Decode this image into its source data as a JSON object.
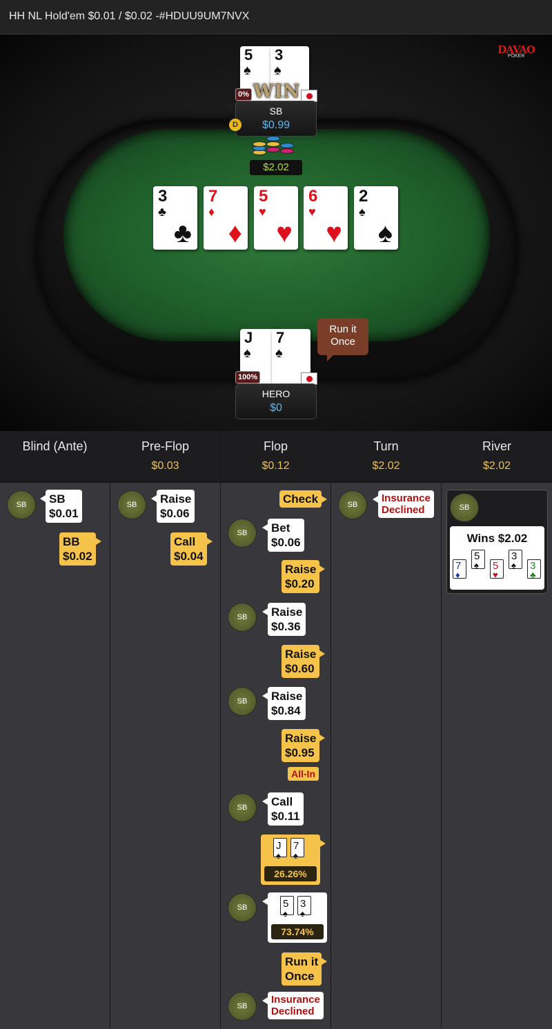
{
  "title": "HH NL Hold'em $0.01 / $0.02 -#HDUU9UM7NVX",
  "logo": {
    "text": "DAVAO",
    "sub": "POKER"
  },
  "table": {
    "top_player": {
      "name": "SB",
      "stack": "$0.99",
      "equity": "0%",
      "win_text": "WIN",
      "dealer": "D",
      "cards": [
        {
          "rank": "5",
          "suit": "♠",
          "color": "black"
        },
        {
          "rank": "3",
          "suit": "♠",
          "color": "black"
        }
      ]
    },
    "pot": "$2.02",
    "board": [
      {
        "rank": "3",
        "suit": "♣",
        "color": "black"
      },
      {
        "rank": "7",
        "suit": "♦",
        "color": "red"
      },
      {
        "rank": "5",
        "suit": "♥",
        "color": "red"
      },
      {
        "rank": "6",
        "suit": "♥",
        "color": "red"
      },
      {
        "rank": "2",
        "suit": "♠",
        "color": "black"
      }
    ],
    "hero": {
      "name": "HERO",
      "stack": "$0",
      "equity": "100%",
      "cards": [
        {
          "rank": "J",
          "suit": "♠",
          "color": "black"
        },
        {
          "rank": "7",
          "suit": "♠",
          "color": "black"
        }
      ]
    },
    "hero_bubble": {
      "line1": "Run it",
      "line2": "Once"
    }
  },
  "history": {
    "columns": [
      {
        "street": "Blind (Ante)",
        "amount": ""
      },
      {
        "street": "Pre-Flop",
        "amount": "$0.03"
      },
      {
        "street": "Flop",
        "amount": "$0.12"
      },
      {
        "street": "Turn",
        "amount": "$2.02"
      },
      {
        "street": "River",
        "amount": "$2.02"
      }
    ],
    "avatar_label": "SB",
    "blind": {
      "sb": {
        "l1": "SB",
        "l2": "$0.01"
      },
      "bb": {
        "l1": "BB",
        "l2": "$0.02"
      }
    },
    "preflop": {
      "raise": {
        "l1": "Raise",
        "l2": "$0.06"
      },
      "call": {
        "l1": "Call",
        "l2": "$0.04"
      }
    },
    "flop": {
      "check": "Check",
      "bet": {
        "l1": "Bet",
        "l2": "$0.06"
      },
      "raise1": {
        "l1": "Raise",
        "l2": "$0.20"
      },
      "raise2": {
        "l1": "Raise",
        "l2": "$0.36"
      },
      "raise3": {
        "l1": "Raise",
        "l2": "$0.60"
      },
      "raise4": {
        "l1": "Raise",
        "l2": "$0.84"
      },
      "raise5": {
        "l1": "Raise",
        "l2": "$0.95"
      },
      "allin": "All-In",
      "call": {
        "l1": "Call",
        "l2": "$0.11"
      },
      "hero_show": {
        "cards": [
          {
            "rank": "J",
            "suit": "♠"
          },
          {
            "rank": "7",
            "suit": "♠"
          }
        ],
        "equity": "26.26%"
      },
      "sb_show": {
        "cards": [
          {
            "rank": "5",
            "suit": "♠"
          },
          {
            "rank": "3",
            "suit": "♠"
          }
        ],
        "equity": "73.74%"
      },
      "rio": {
        "l1": "Run it",
        "l2": "Once"
      },
      "ins": {
        "l1": "Insurance",
        "l2": "Declined"
      }
    },
    "turn": {
      "ins": {
        "l1": "Insurance",
        "l2": "Declined"
      }
    },
    "river": {
      "wins": "Wins $2.02",
      "cards": [
        {
          "rank": "7",
          "suit": "♦",
          "color": "#1a3aa0"
        },
        {
          "rank": "5",
          "suit": "♠",
          "color": "#111111"
        },
        {
          "rank": "5",
          "suit": "♥",
          "color": "#d01020"
        },
        {
          "rank": "3",
          "suit": "♠",
          "color": "#111111"
        },
        {
          "rank": "3",
          "suit": "♣",
          "color": "#1e8a2a"
        }
      ]
    }
  }
}
